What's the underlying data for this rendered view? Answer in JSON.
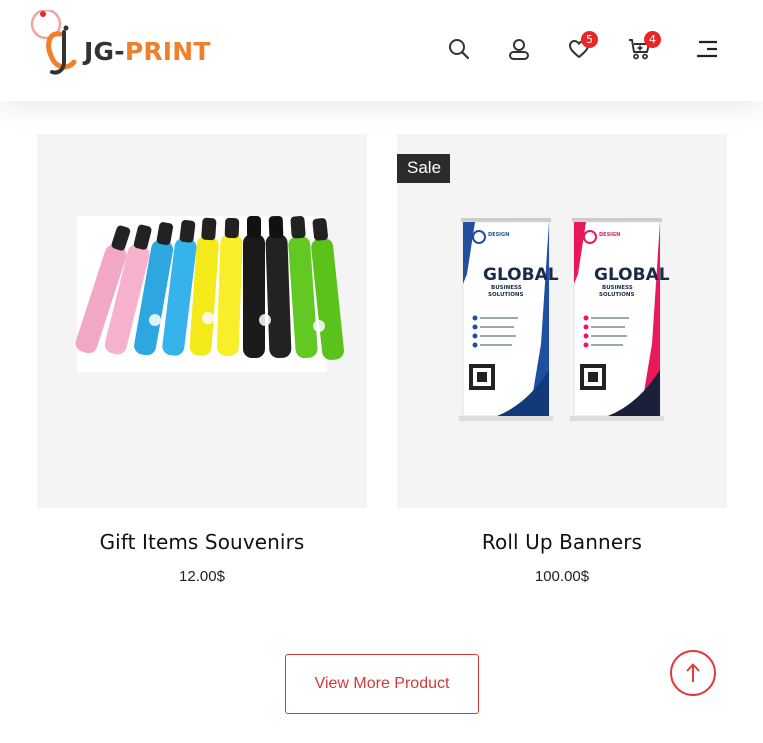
{
  "brand": {
    "logo_part1": "JG-",
    "logo_part2": "PRINT",
    "accent_color": "#f07f2a",
    "primary_red": "#e8262a"
  },
  "header": {
    "icons": [
      "search-icon",
      "user-icon",
      "heart-icon",
      "cart-icon",
      "menu-icon"
    ],
    "wishlist_count": "5",
    "cart_count": "4"
  },
  "products": [
    {
      "title": "Gift Items Souvenirs",
      "price": "12.00$",
      "sale": ""
    },
    {
      "title": "Roll Up Banners",
      "price": "100.00$",
      "sale": "Sale"
    }
  ],
  "banners": {
    "brand_small": "DESIGN",
    "headline": "GLOBAL",
    "subline1": "BUSINESS",
    "subline2": "SOLUTIONS"
  },
  "actions": {
    "view_more": "View More Product"
  }
}
